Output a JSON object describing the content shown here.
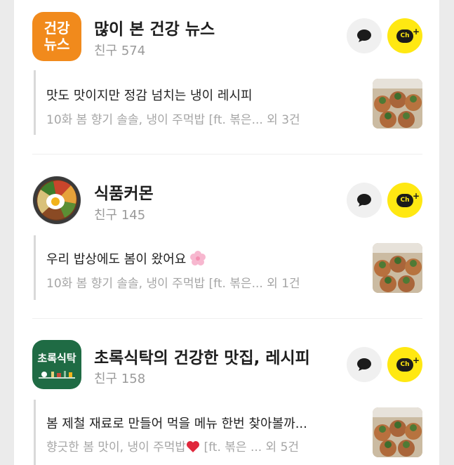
{
  "channels": [
    {
      "avatar_text": [
        "건강",
        "뉴스"
      ],
      "name": "많이 본 건강 뉴스",
      "friends": "친구 574",
      "post_title": "맛도 맛이지만 정감 넘치는 냉이 레시피",
      "post_sub": "10화 봄 향기 솔솔, 냉이 주먹밥 [ft. 볶은... 외 3건"
    },
    {
      "name": "식품커몬",
      "friends": "친구 145",
      "post_title": "우리 밥상에도 봄이 왔어요",
      "post_sub": "10화 봄 향기 솔솔, 냉이 주먹밥 [ft. 볶은... 외 1건"
    },
    {
      "avatar_text": [
        "초록식탁"
      ],
      "name": "초록식탁의 건강한 맛집, 레시피",
      "friends": "친구 158",
      "post_title": "봄 제철 재료로 만들어 먹을 메뉴 한번 찾아볼까...",
      "post_sub_pre": "향긋한 봄 맛이, 냉이 주먹밥",
      "post_sub_post": " [ft. 볶은 ... 외 5건"
    }
  ],
  "buttons": {
    "chat_icon": "speech-bubble-icon",
    "channel_add_label": "Ch"
  },
  "colors": {
    "channel_yellow": "#ffe812",
    "news_orange": "#f18a1c",
    "green_brand": "#1f6b44"
  }
}
